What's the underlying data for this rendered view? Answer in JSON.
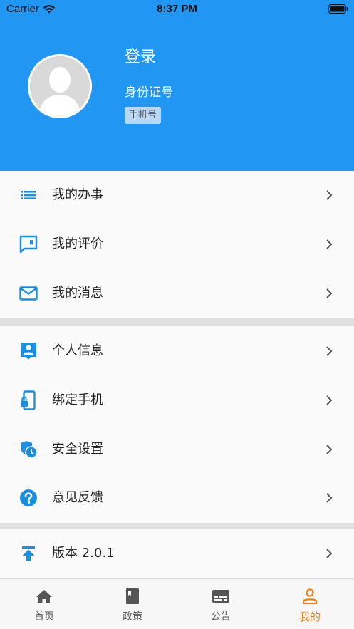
{
  "status_bar": {
    "carrier": "Carrier",
    "time": "8:37 PM"
  },
  "profile": {
    "name": "登录",
    "id_label": "身份证号",
    "phone_badge": "手机号"
  },
  "menu": {
    "group1": [
      {
        "label": "我的办事",
        "icon": "list-icon"
      },
      {
        "label": "我的评价",
        "icon": "comment-icon"
      },
      {
        "label": "我的消息",
        "icon": "mail-icon"
      }
    ],
    "group2": [
      {
        "label": "个人信息",
        "icon": "contact-icon"
      },
      {
        "label": "绑定手机",
        "icon": "phone-lock-icon"
      },
      {
        "label": "安全设置",
        "icon": "security-clock-icon"
      },
      {
        "label": "意见反馈",
        "icon": "help-icon"
      }
    ],
    "group3": [
      {
        "label": "版本 2.0.1",
        "icon": "upload-icon"
      }
    ]
  },
  "tabbar": {
    "items": [
      {
        "label": "首页",
        "icon": "home-icon"
      },
      {
        "label": "政策",
        "icon": "book-icon"
      },
      {
        "label": "公告",
        "icon": "notice-icon"
      },
      {
        "label": "我的",
        "icon": "person-icon",
        "active": true
      }
    ]
  },
  "colors": {
    "primary": "#2196f3",
    "icon_blue": "#1a8fe0",
    "active_tab": "#ef7f1a"
  }
}
